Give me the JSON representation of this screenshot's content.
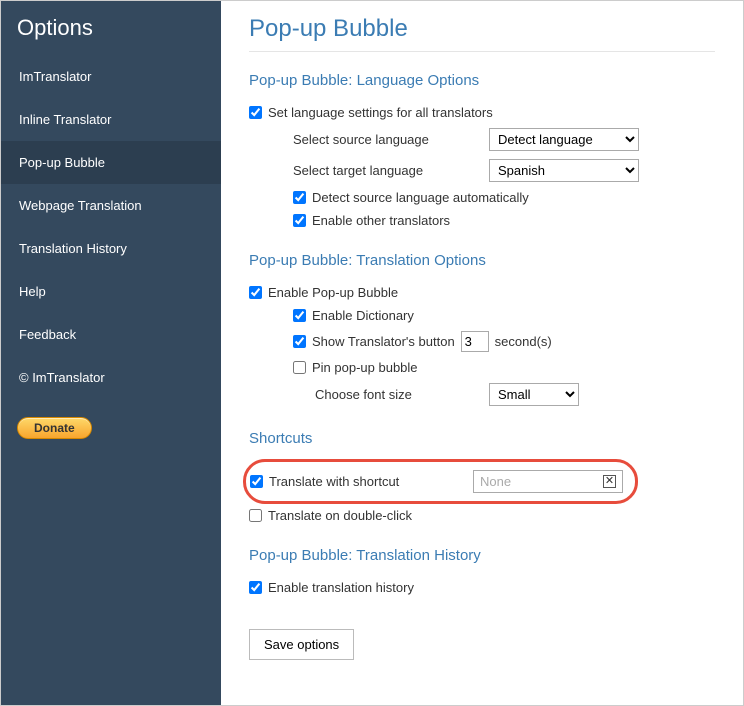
{
  "sidebar": {
    "title": "Options",
    "items": [
      {
        "label": "ImTranslator"
      },
      {
        "label": "Inline Translator"
      },
      {
        "label": "Pop-up Bubble"
      },
      {
        "label": "Webpage Translation"
      },
      {
        "label": "Translation History"
      },
      {
        "label": "Help"
      },
      {
        "label": "Feedback"
      },
      {
        "label": "© ImTranslator"
      }
    ],
    "donate_label": "Donate"
  },
  "main": {
    "title": "Pop-up Bubble",
    "language_section": {
      "heading": "Pop-up Bubble: Language Options",
      "set_all_label": "Set language settings for all translators",
      "source_label": "Select source language",
      "source_value": "Detect language",
      "target_label": "Select target language",
      "target_value": "Spanish",
      "detect_auto_label": "Detect source language automatically",
      "enable_other_label": "Enable other translators"
    },
    "translation_section": {
      "heading": "Pop-up Bubble: Translation Options",
      "enable_bubble_label": "Enable Pop-up Bubble",
      "enable_dictionary_label": "Enable Dictionary",
      "show_button_label": "Show Translator's button",
      "show_button_seconds": "3",
      "seconds_suffix": "second(s)",
      "pin_bubble_label": "Pin pop-up bubble",
      "font_size_label": "Choose font size",
      "font_size_value": "Small"
    },
    "shortcuts_section": {
      "heading": "Shortcuts",
      "translate_shortcut_label": "Translate with shortcut",
      "shortcut_value": "None",
      "double_click_label": "Translate on double-click"
    },
    "history_section": {
      "heading": "Pop-up Bubble: Translation History",
      "enable_history_label": "Enable translation history"
    },
    "save_button_label": "Save options"
  }
}
